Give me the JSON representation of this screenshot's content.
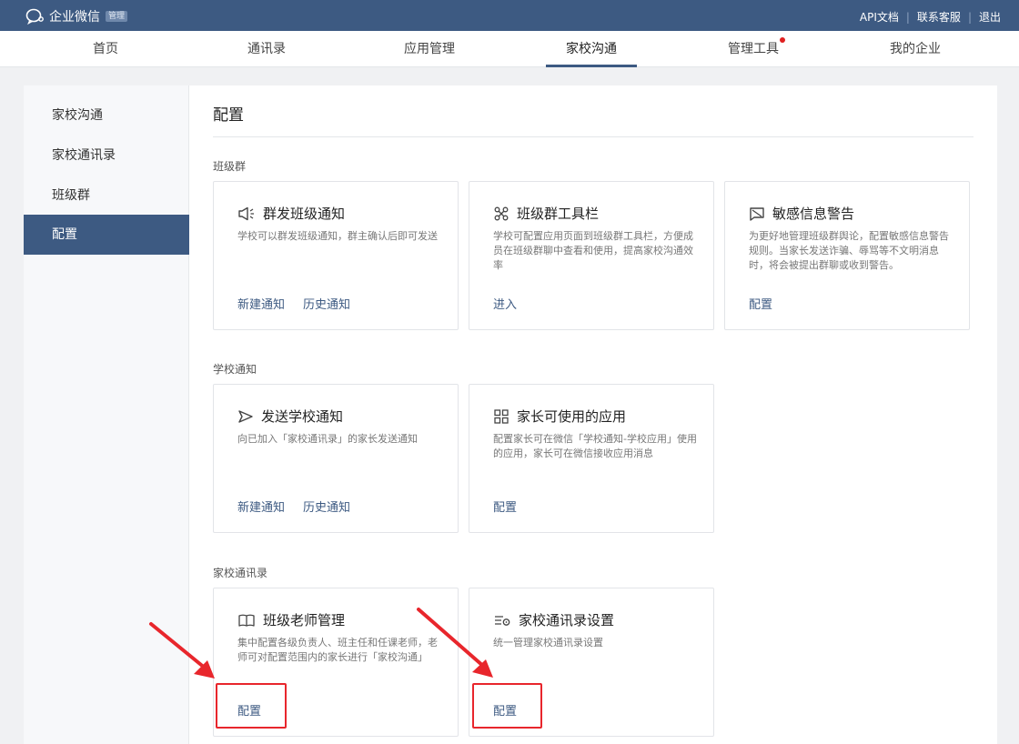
{
  "app": {
    "name": "企业微信",
    "badge": "管理"
  },
  "toplinks": [
    "API文档",
    "联系客服",
    "退出"
  ],
  "nav": [
    "首页",
    "通讯录",
    "应用管理",
    "家校沟通",
    "管理工具",
    "我的企业"
  ],
  "sidebar": [
    "家校沟通",
    "家校通讯录",
    "班级群",
    "配置"
  ],
  "page_title": "配置",
  "sections": [
    {
      "label": "班级群",
      "cards": [
        {
          "icon": "megaphone-icon",
          "title": "群发班级通知",
          "desc": "学校可以群发班级通知，群主确认后即可发送",
          "actions": [
            "新建通知",
            "历史通知"
          ]
        },
        {
          "icon": "toolbar-icon",
          "title": "班级群工具栏",
          "desc": "学校可配置应用页面到班级群工具栏，方便成员在班级群聊中查看和使用，提高家校沟通效率",
          "actions": [
            "进入"
          ]
        },
        {
          "icon": "warning-flag-icon",
          "title": "敏感信息警告",
          "desc": "为更好地管理班级群舆论，配置敏感信息警告规则。当家长发送诈骗、辱骂等不文明消息时，将会被提出群聊或收到警告。",
          "actions": [
            "配置"
          ]
        }
      ]
    },
    {
      "label": "学校通知",
      "cards": [
        {
          "icon": "send-icon",
          "title": "发送学校通知",
          "desc": "向已加入「家校通讯录」的家长发送通知",
          "actions": [
            "新建通知",
            "历史通知"
          ]
        },
        {
          "icon": "apps-grid-icon",
          "title": "家长可使用的应用",
          "desc": "配置家长可在微信「学校通知-学校应用」使用的应用，家长可在微信接收应用消息",
          "actions": [
            "配置"
          ]
        }
      ]
    },
    {
      "label": "家校通讯录",
      "cards": [
        {
          "icon": "book-icon",
          "title": "班级老师管理",
          "desc": "集中配置各级负责人、班主任和任课老师，老师可对配置范围内的家长进行「家校沟通」",
          "actions": [
            "配置"
          ]
        },
        {
          "icon": "list-settings-icon",
          "title": "家校通讯录设置",
          "desc": "统一管理家校通讯录设置",
          "actions": [
            "配置"
          ]
        }
      ]
    }
  ],
  "colors": {
    "brand": "#3d5a82",
    "highlight": "#e8262c",
    "notice_dot": "#e02020"
  }
}
